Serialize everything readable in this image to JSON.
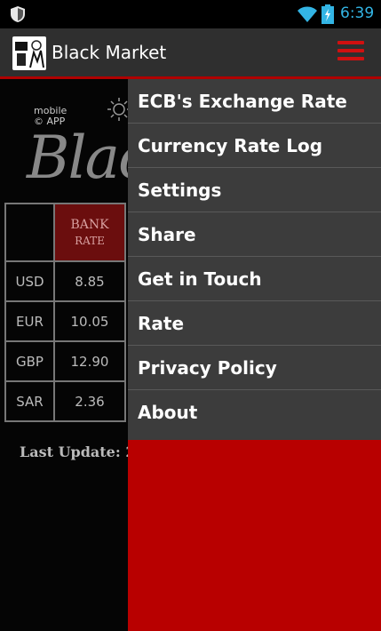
{
  "status_bar": {
    "time": "6:39",
    "icons": [
      "shield-icon",
      "wifi-icon",
      "battery-charging-icon"
    ],
    "time_color": "#33b5e5"
  },
  "action_bar": {
    "title": "Black Market",
    "menu_icon": "hamburger-menu-icon",
    "menu_color": "#d01010"
  },
  "background": {
    "logo_small_line1": "mobile",
    "logo_small_line2": "© APP",
    "logo_big": "Blac",
    "table": {
      "header": {
        "col1": "",
        "col2_line1": "BANK",
        "col2_line2": "RATE"
      },
      "rows": [
        {
          "currency": "USD",
          "rate": "8.85"
        },
        {
          "currency": "EUR",
          "rate": "10.05"
        },
        {
          "currency": "GBP",
          "rate": "12.90"
        },
        {
          "currency": "SAR",
          "rate": "2.36"
        }
      ]
    },
    "last_update": "Last Update: 2"
  },
  "drawer": {
    "items": [
      "ECB's Exchange Rate",
      "Currency Rate Log",
      "Settings",
      "Share",
      "Get in Touch",
      "Rate",
      "Privacy Policy",
      "About"
    ],
    "colors": {
      "list_bg": "#3c3c3c",
      "accent_red": "#b80000"
    }
  }
}
